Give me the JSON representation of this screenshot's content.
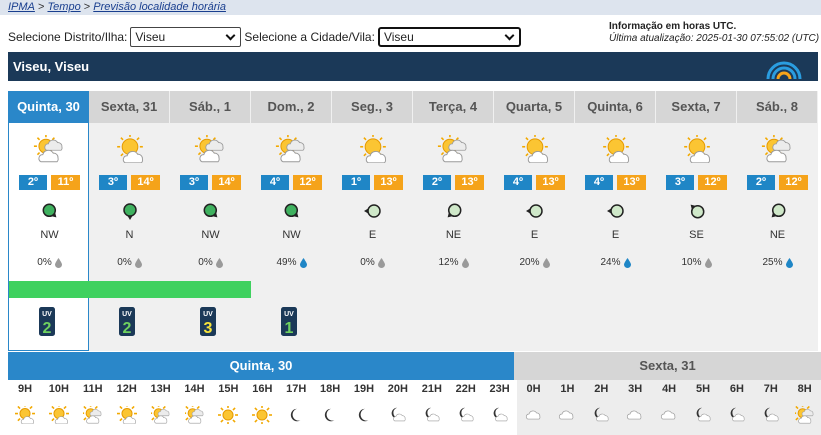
{
  "breadcrumb": {
    "home": "IPMA",
    "sep1": ">",
    "tempo": "Tempo",
    "sep2": ">",
    "current": "Previsão localidade horária"
  },
  "selectors": {
    "district_label": "Selecione Distrito/Ilha:",
    "district_value": "Viseu",
    "city_label": "Selecione a Cidade/Vila:",
    "city_value": "Viseu"
  },
  "info": {
    "utc_note": "Informação em horas UTC.",
    "updated": "Última atualização: 2025-01-30 07:55:02 (UTC)"
  },
  "location": {
    "title": "Viseu, Viseu"
  },
  "colors": {
    "header": "#1b3958",
    "selected": "#2a87c9",
    "tmin": "#1f86c6",
    "tmax": "#f5a31a",
    "green": "#3fd15f"
  },
  "days": [
    {
      "label": "Quinta, 30",
      "icon": "partly-cloudy-icon",
      "tmin": "2º",
      "tmax": "11º",
      "wind_dir": "NW",
      "precip": "0%",
      "drop": "grey",
      "green": true,
      "uv": "2",
      "selected": true
    },
    {
      "label": "Sexta, 31",
      "icon": "sun-cloud-icon",
      "tmin": "3º",
      "tmax": "14º",
      "wind_dir": "N",
      "precip": "0%",
      "drop": "grey",
      "green": true,
      "uv": "2",
      "selected": false
    },
    {
      "label": "Sáb., 1",
      "icon": "partly-cloudy-icon",
      "tmin": "3º",
      "tmax": "14º",
      "wind_dir": "NW",
      "precip": "0%",
      "drop": "grey",
      "green": true,
      "uv": "3",
      "selected": false
    },
    {
      "label": "Dom., 2",
      "icon": "partly-cloudy-icon",
      "tmin": "4º",
      "tmax": "12º",
      "wind_dir": "NW",
      "precip": "49%",
      "drop": "blue",
      "green": false,
      "uv": "1",
      "selected": false
    },
    {
      "label": "Seg., 3",
      "icon": "sun-cloud-icon",
      "tmin": "1º",
      "tmax": "13º",
      "wind_dir": "E",
      "precip": "0%",
      "drop": "grey",
      "green": false,
      "uv": "",
      "selected": false
    },
    {
      "label": "Terça, 4",
      "icon": "partly-cloudy-icon",
      "tmin": "2º",
      "tmax": "13º",
      "wind_dir": "NE",
      "precip": "12%",
      "drop": "grey",
      "green": false,
      "uv": "",
      "selected": false
    },
    {
      "label": "Quarta, 5",
      "icon": "sun-cloud-icon",
      "tmin": "4º",
      "tmax": "13º",
      "wind_dir": "E",
      "precip": "20%",
      "drop": "grey",
      "green": false,
      "uv": "",
      "selected": false
    },
    {
      "label": "Quinta, 6",
      "icon": "sun-cloud-icon",
      "tmin": "4º",
      "tmax": "13º",
      "wind_dir": "E",
      "precip": "24%",
      "drop": "blue",
      "green": false,
      "uv": "",
      "selected": false
    },
    {
      "label": "Sexta, 7",
      "icon": "sun-cloud-icon",
      "tmin": "3º",
      "tmax": "12º",
      "wind_dir": "SE",
      "precip": "10%",
      "drop": "grey",
      "green": false,
      "uv": "",
      "selected": false
    },
    {
      "label": "Sáb., 8",
      "icon": "partly-cloudy-icon",
      "tmin": "2º",
      "tmax": "12º",
      "wind_dir": "NE",
      "precip": "25%",
      "drop": "blue",
      "green": false,
      "uv": "",
      "selected": false
    }
  ],
  "hourly": {
    "day1_label": "Quinta, 30",
    "day2_label": "Sexta, 31",
    "hours": [
      {
        "h": "9H",
        "icon": "sun-cloud-icon",
        "day": 1
      },
      {
        "h": "10H",
        "icon": "sun-cloud-icon",
        "day": 1
      },
      {
        "h": "11H",
        "icon": "partly-cloudy-icon",
        "day": 1
      },
      {
        "h": "12H",
        "icon": "sun-cloud-icon",
        "day": 1
      },
      {
        "h": "13H",
        "icon": "partly-cloudy-icon",
        "day": 1
      },
      {
        "h": "14H",
        "icon": "partly-cloudy-icon",
        "day": 1
      },
      {
        "h": "15H",
        "icon": "sun-icon",
        "day": 1
      },
      {
        "h": "16H",
        "icon": "sun-icon",
        "day": 1
      },
      {
        "h": "17H",
        "icon": "moon-icon",
        "day": 1
      },
      {
        "h": "18H",
        "icon": "moon-icon",
        "day": 1
      },
      {
        "h": "19H",
        "icon": "moon-icon",
        "day": 1
      },
      {
        "h": "20H",
        "icon": "moon-cloud-icon",
        "day": 1
      },
      {
        "h": "21H",
        "icon": "moon-cloud-icon",
        "day": 1
      },
      {
        "h": "22H",
        "icon": "moon-cloud-icon",
        "day": 1
      },
      {
        "h": "23H",
        "icon": "moon-cloud-icon",
        "day": 1
      },
      {
        "h": "0H",
        "icon": "cloud-icon",
        "day": 2
      },
      {
        "h": "1H",
        "icon": "cloud-icon",
        "day": 2
      },
      {
        "h": "2H",
        "icon": "moon-cloud-icon",
        "day": 2
      },
      {
        "h": "3H",
        "icon": "cloud-icon",
        "day": 2
      },
      {
        "h": "4H",
        "icon": "cloud-icon",
        "day": 2
      },
      {
        "h": "5H",
        "icon": "moon-cloud-icon",
        "day": 2
      },
      {
        "h": "6H",
        "icon": "moon-cloud-icon",
        "day": 2
      },
      {
        "h": "7H",
        "icon": "moon-cloud-icon",
        "day": 2
      },
      {
        "h": "8H",
        "icon": "partly-cloudy-icon",
        "day": 2
      }
    ]
  }
}
